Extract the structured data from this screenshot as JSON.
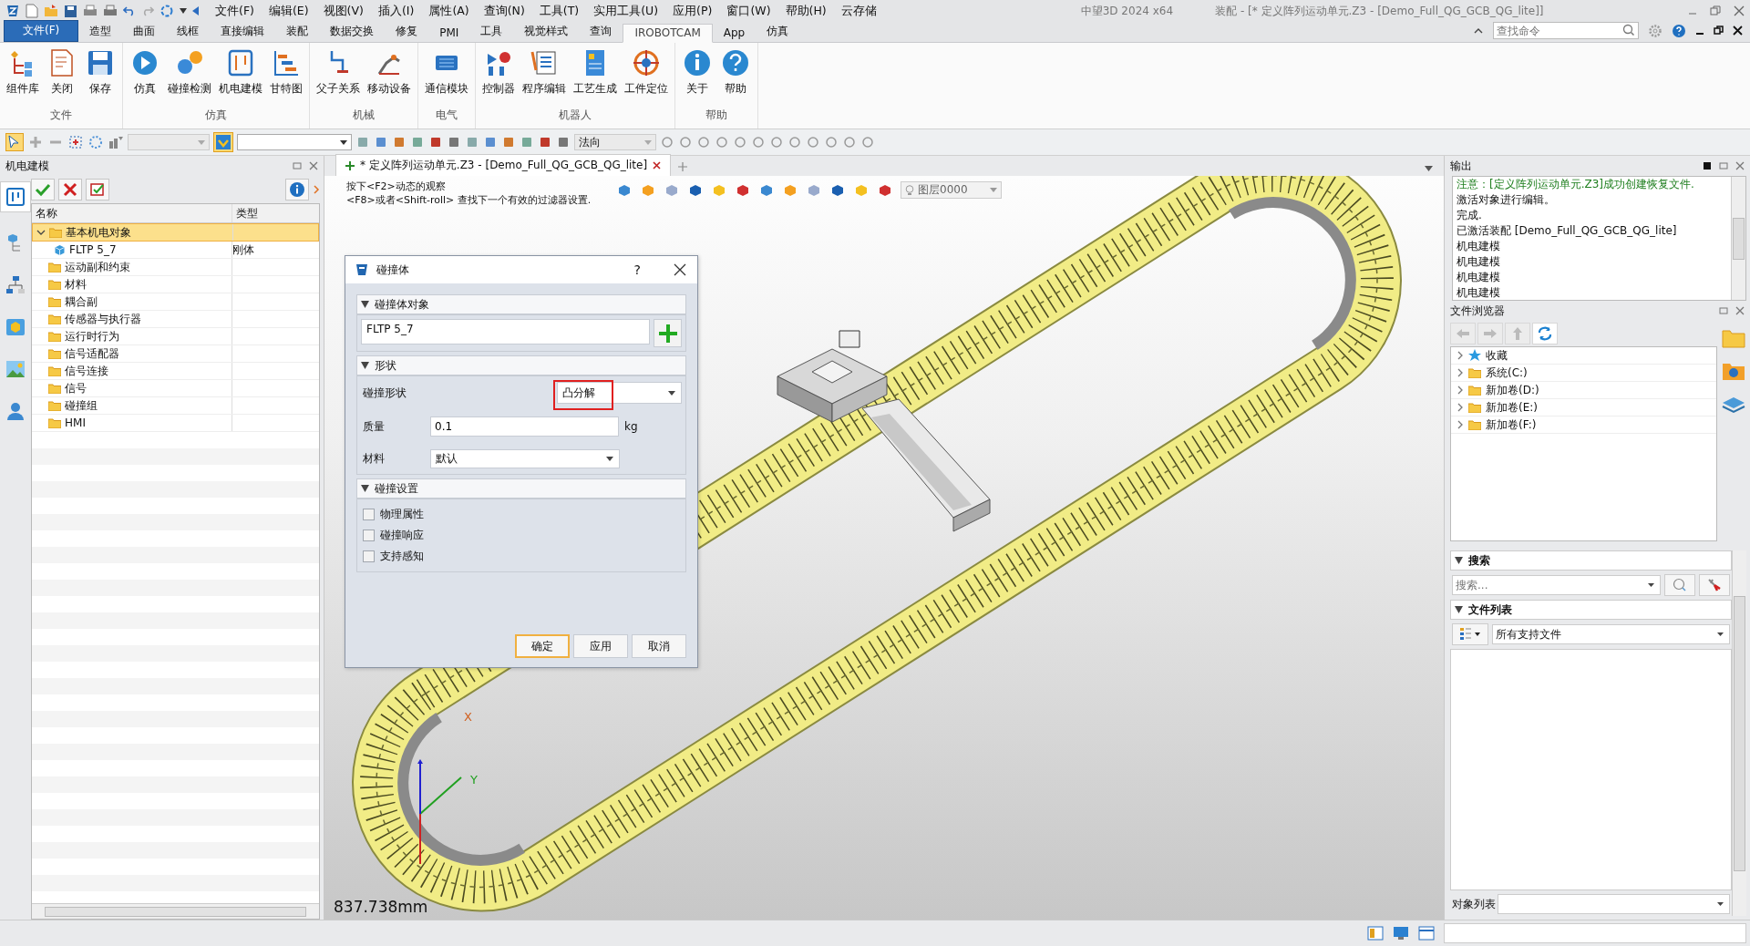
{
  "app_title": "中望3D 2024 x64",
  "doc_title": "装配 - [* 定义阵列运动单元.Z3 - [Demo_Full_QG_GCB_QG_lite]]",
  "menu": [
    "文件(F)",
    "编辑(E)",
    "视图(V)",
    "插入(I)",
    "属性(A)",
    "查询(N)",
    "工具(T)",
    "实用工具(U)",
    "应用(P)",
    "窗口(W)",
    "帮助(H)",
    "云存储"
  ],
  "command_search": {
    "placeholder": "查找命令"
  },
  "ribbon_tabs": [
    {
      "label": "文件(F)",
      "kind": "file",
      "selected": false
    },
    {
      "label": "造型",
      "kind": "tab",
      "selected": false
    },
    {
      "label": "曲面",
      "kind": "tab",
      "selected": false
    },
    {
      "label": "线框",
      "kind": "tab",
      "selected": false
    },
    {
      "label": "直接编辑",
      "kind": "tab",
      "selected": false
    },
    {
      "label": "装配",
      "kind": "tab",
      "selected": false
    },
    {
      "label": "数据交换",
      "kind": "tab",
      "selected": false
    },
    {
      "label": "修复",
      "kind": "tab",
      "selected": false
    },
    {
      "label": "PMI",
      "kind": "tab",
      "selected": false
    },
    {
      "label": "工具",
      "kind": "tab",
      "selected": false
    },
    {
      "label": "视觉样式",
      "kind": "tab",
      "selected": false
    },
    {
      "label": "查询",
      "kind": "tab",
      "selected": false
    },
    {
      "label": "IROBOTCAM",
      "kind": "tab",
      "selected": true
    },
    {
      "label": "App",
      "kind": "tab",
      "selected": false
    },
    {
      "label": "仿真",
      "kind": "tab",
      "selected": false
    }
  ],
  "ribbon_groups": [
    {
      "label": "文件",
      "buttons": [
        "组件库",
        "关闭",
        "保存"
      ]
    },
    {
      "label": "仿真",
      "buttons": [
        "仿真",
        "碰撞检测",
        "机电建模",
        "甘特图"
      ]
    },
    {
      "label": "机械",
      "buttons": [
        "父子关系",
        "移动设备"
      ]
    },
    {
      "label": "电气",
      "buttons": [
        "通信模块"
      ]
    },
    {
      "label": "机器人",
      "buttons": [
        "控制器",
        "程序编辑",
        "工艺生成",
        "工件定位"
      ]
    },
    {
      "label": "帮助",
      "buttons": [
        "关于",
        "帮助"
      ]
    }
  ],
  "toolbar": {
    "direction": "法向"
  },
  "left_panel": {
    "title": "机电建模",
    "columns": [
      "名称",
      "类型"
    ],
    "tree": [
      {
        "name": "基本机电对象",
        "selected": true,
        "expanded": true,
        "children": [
          {
            "name": "FLTP 5_7",
            "type": "刚体",
            "selected": false
          }
        ]
      },
      {
        "name": "运动副和约束",
        "selected": false
      },
      {
        "name": "材料",
        "selected": false
      },
      {
        "name": "耦合副",
        "selected": false
      },
      {
        "name": "传感器与执行器",
        "selected": false
      },
      {
        "name": "运行时行为",
        "selected": false
      },
      {
        "name": "信号适配器",
        "selected": false
      },
      {
        "name": "信号连接",
        "selected": false
      },
      {
        "name": "信号",
        "selected": false
      },
      {
        "name": "碰撞组",
        "selected": false
      },
      {
        "name": "HMI",
        "selected": false
      }
    ]
  },
  "document_tab": {
    "title": "* 定义阵列运动单元.Z3 - [Demo_Full_QG_GCB_QG_lite]"
  },
  "viewport": {
    "hints": [
      "按下<F2>动态的观察",
      "<F8>或者<Shift-roll> 查找下一个有效的过滤器设置."
    ],
    "layer": "图层0000",
    "scale": "837.738mm",
    "axis_labels": [
      "X",
      "Y"
    ]
  },
  "dialog": {
    "title": "碰撞体",
    "help": "?",
    "object_section": "碰撞体对象",
    "object_value": "FLTP 5_7",
    "shape_section": "形状",
    "shape_label": "碰撞形状",
    "shape_value": "凸分解",
    "shape_highlighted": true,
    "mass_label": "质量",
    "mass_value": "0.1",
    "mass_unit": "kg",
    "material_label": "材料",
    "material_value": "默认",
    "settings_section": "碰撞设置",
    "options": [
      {
        "label": "物理属性",
        "checked": false
      },
      {
        "label": "碰撞响应",
        "checked": false
      },
      {
        "label": "支持感知",
        "checked": false
      }
    ],
    "buttons": [
      {
        "label": "确定",
        "default": true
      },
      {
        "label": "应用",
        "default": false
      },
      {
        "label": "取消",
        "default": false
      }
    ]
  },
  "output": {
    "title": "输出",
    "lines": [
      {
        "text": "注意：[定义阵列运动单元.Z3]成功创建恢复文件.",
        "kind": "notice"
      },
      {
        "text": "激活对象进行编辑。",
        "kind": "plain"
      },
      {
        "text": "完成.",
        "kind": "plain"
      },
      {
        "text": "已激活装配 [Demo_Full_QG_GCB_QG_lite]",
        "kind": "plain"
      },
      {
        "text": "机电建模",
        "kind": "plain"
      },
      {
        "text": "机电建模",
        "kind": "plain"
      },
      {
        "text": "机电建模",
        "kind": "plain"
      },
      {
        "text": "机电建模",
        "kind": "plain"
      }
    ]
  },
  "file_browser": {
    "title": "文件浏览器",
    "items": [
      {
        "label": "收藏",
        "kind": "favorites"
      },
      {
        "label": "系统(C:)",
        "kind": "drive"
      },
      {
        "label": "新加卷(D:)",
        "kind": "drive"
      },
      {
        "label": "新加卷(E:)",
        "kind": "drive"
      },
      {
        "label": "新加卷(F:)",
        "kind": "drive"
      }
    ],
    "search_section": "搜索",
    "search_placeholder": "搜索...",
    "file_list_section": "文件列表",
    "file_filter": "所有支持文件",
    "object_list_label": "对象列表"
  }
}
